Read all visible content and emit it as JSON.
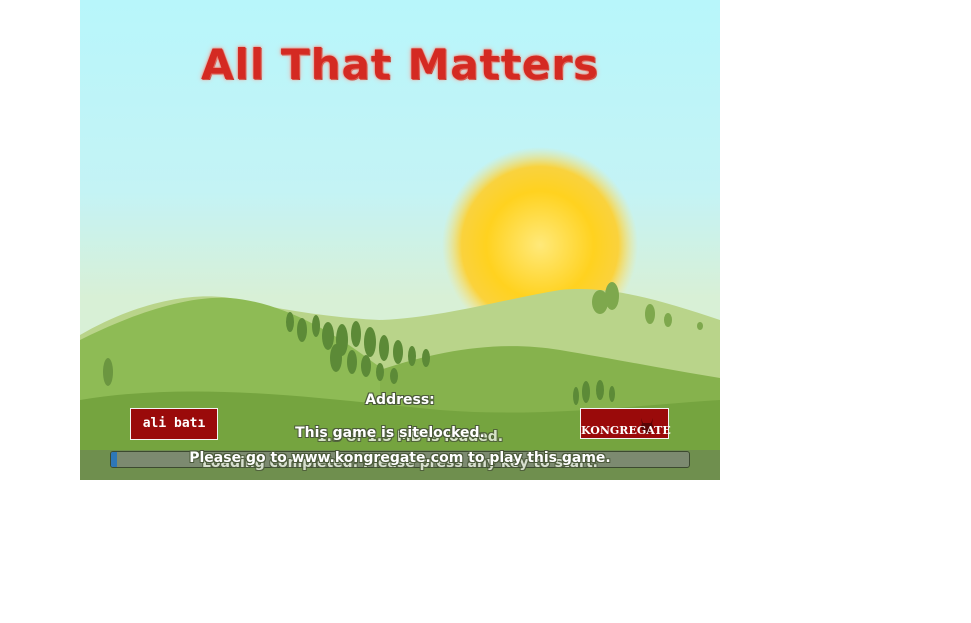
{
  "game": {
    "title": "All That Matters",
    "address_label": "Address:",
    "loaded_text": "1.5 of 1.5 MB is loaded.",
    "sitelocked_text": "This game is sitelocked.",
    "completed_text": "Loading completed. Please press any key to start.",
    "redirect_text": "Please go to www.kongregate.com to play this game.",
    "left_badge": "ali batı",
    "right_badge": "KONGREGATE",
    "progress_fraction": 0.01
  },
  "colors": {
    "sky": "#b8f6fb",
    "sun": "#ffd21f",
    "hills": "#7fae4a",
    "title": "#d42a22",
    "badge": "#9a0a0a",
    "progress_fill": "#2e77b8"
  },
  "icons": {
    "right_badge_icon": "devil-head-icon"
  }
}
